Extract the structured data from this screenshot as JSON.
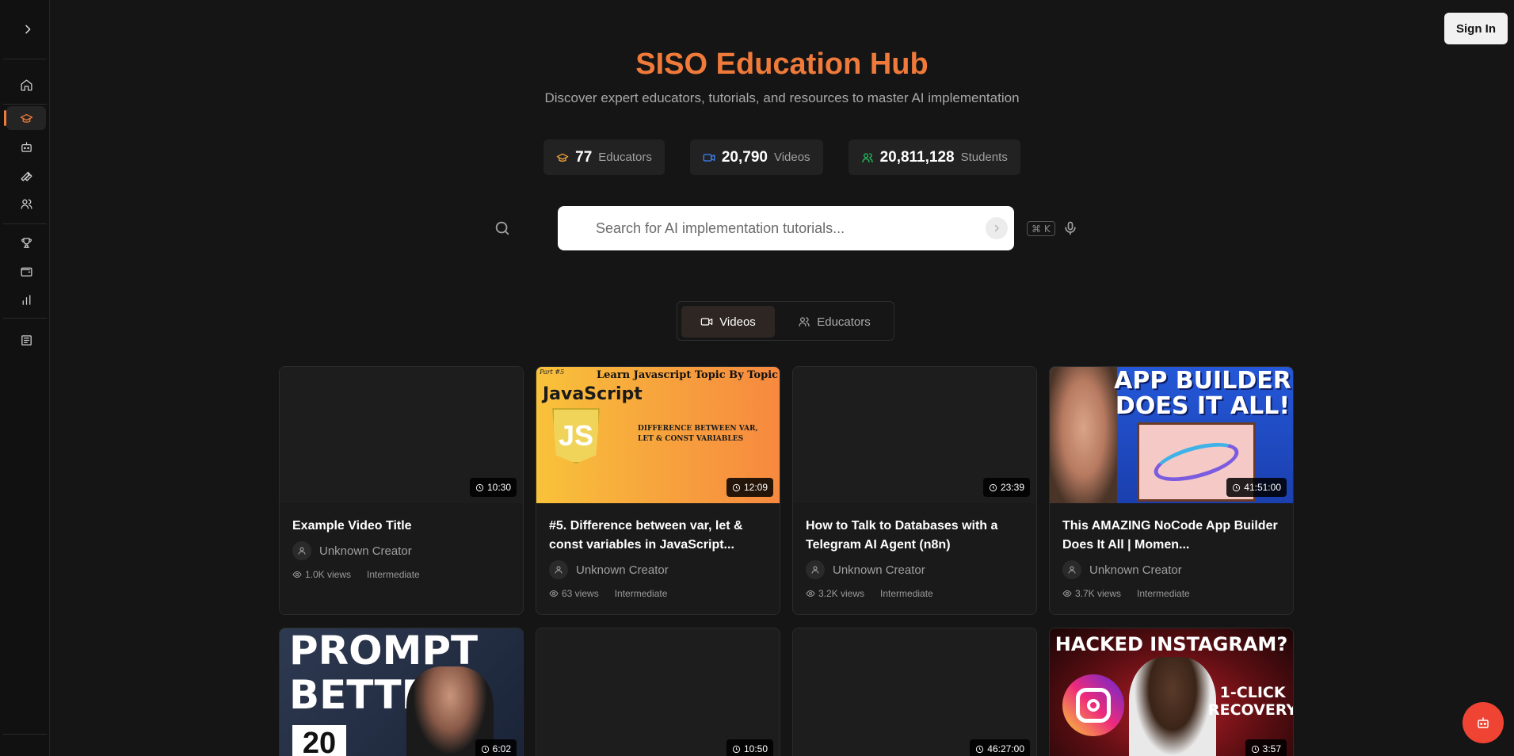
{
  "sidebar": {
    "toggle_icon": "chevron-right-icon",
    "items": [
      {
        "id": "home",
        "icon": "home-icon",
        "active": false
      },
      {
        "id": "education",
        "icon": "graduation-cap-icon",
        "active": true
      },
      {
        "id": "bot",
        "icon": "bot-icon",
        "active": false
      },
      {
        "id": "tools",
        "icon": "wrench-icon",
        "active": false
      },
      {
        "id": "community",
        "icon": "users-icon",
        "active": false
      },
      {
        "id": "leaderboard",
        "icon": "trophy-icon",
        "active": false
      },
      {
        "id": "wallet",
        "icon": "wallet-icon",
        "active": false
      },
      {
        "id": "analytics",
        "icon": "bar-chart-icon",
        "active": false
      },
      {
        "id": "news",
        "icon": "newspaper-icon",
        "active": false
      }
    ],
    "accent": "#f07a3a"
  },
  "header": {
    "signin_label": "Sign In"
  },
  "hero": {
    "title": "SISO Education Hub",
    "subtitle": "Discover expert educators, tutorials, and resources to master AI implementation",
    "title_color": "#f07a3a"
  },
  "stats": [
    {
      "value": "77",
      "label": "Educators",
      "icon": "graduation-cap-icon",
      "color": "#f0a13a"
    },
    {
      "value": "20,790",
      "label": "Videos",
      "icon": "video-icon",
      "color": "#3b82f6"
    },
    {
      "value": "20,811,128",
      "label": "Students",
      "icon": "users-icon",
      "color": "#22c55e"
    }
  ],
  "search": {
    "placeholder": "Search for AI implementation tutorials...",
    "value": "",
    "shortcut": "⌘ K"
  },
  "tabs": [
    {
      "label": "Videos",
      "icon": "video-icon",
      "active": true
    },
    {
      "label": "Educators",
      "icon": "users-icon",
      "active": false
    }
  ],
  "videos": [
    {
      "title": "Example Video Title",
      "duration": "10:30",
      "creator": "Unknown Creator",
      "views": "1.0K views",
      "level": "Intermediate"
    },
    {
      "title": "#5. Difference between var, let & const variables in JavaScript...",
      "duration": "12:09",
      "creator": "Unknown Creator",
      "views": "63 views",
      "level": "Intermediate",
      "thumb": {
        "t1": "Part #5",
        "t2": "Learn Javascript Topic By Topic",
        "t3": "JavaScript",
        "shield": "JS",
        "t4a": "DIFFERENCE BETWEEN VAR,",
        "t4b": "LET & CONST VARIABLES"
      }
    },
    {
      "title": "How to Talk to Databases with a Telegram AI Agent (n8n)",
      "duration": "23:39",
      "creator": "Unknown Creator",
      "views": "3.2K views",
      "level": "Intermediate"
    },
    {
      "title": "This AMAZING NoCode App Builder Does It All | Momen...",
      "duration": "41:51:00",
      "creator": "Unknown Creator",
      "views": "3.7K views",
      "level": "Intermediate",
      "thumb": {
        "h1a": "APP BUILDER",
        "h1b": "DOES IT ALL!"
      }
    },
    {
      "duration": "6:02",
      "thumb": {
        "p1": "PROMPT",
        "p2": "BETTER",
        "p3": "20"
      }
    },
    {
      "duration": "10:50"
    },
    {
      "duration": "46:27:00"
    },
    {
      "duration": "3:57",
      "thumb": {
        "h1": "HACKED INSTAGRAM?",
        "r1a": "1-CLICK",
        "r1b": "RECOVERY"
      }
    }
  ],
  "assistant": {
    "icon": "bot-icon",
    "color": "#ef4434"
  }
}
